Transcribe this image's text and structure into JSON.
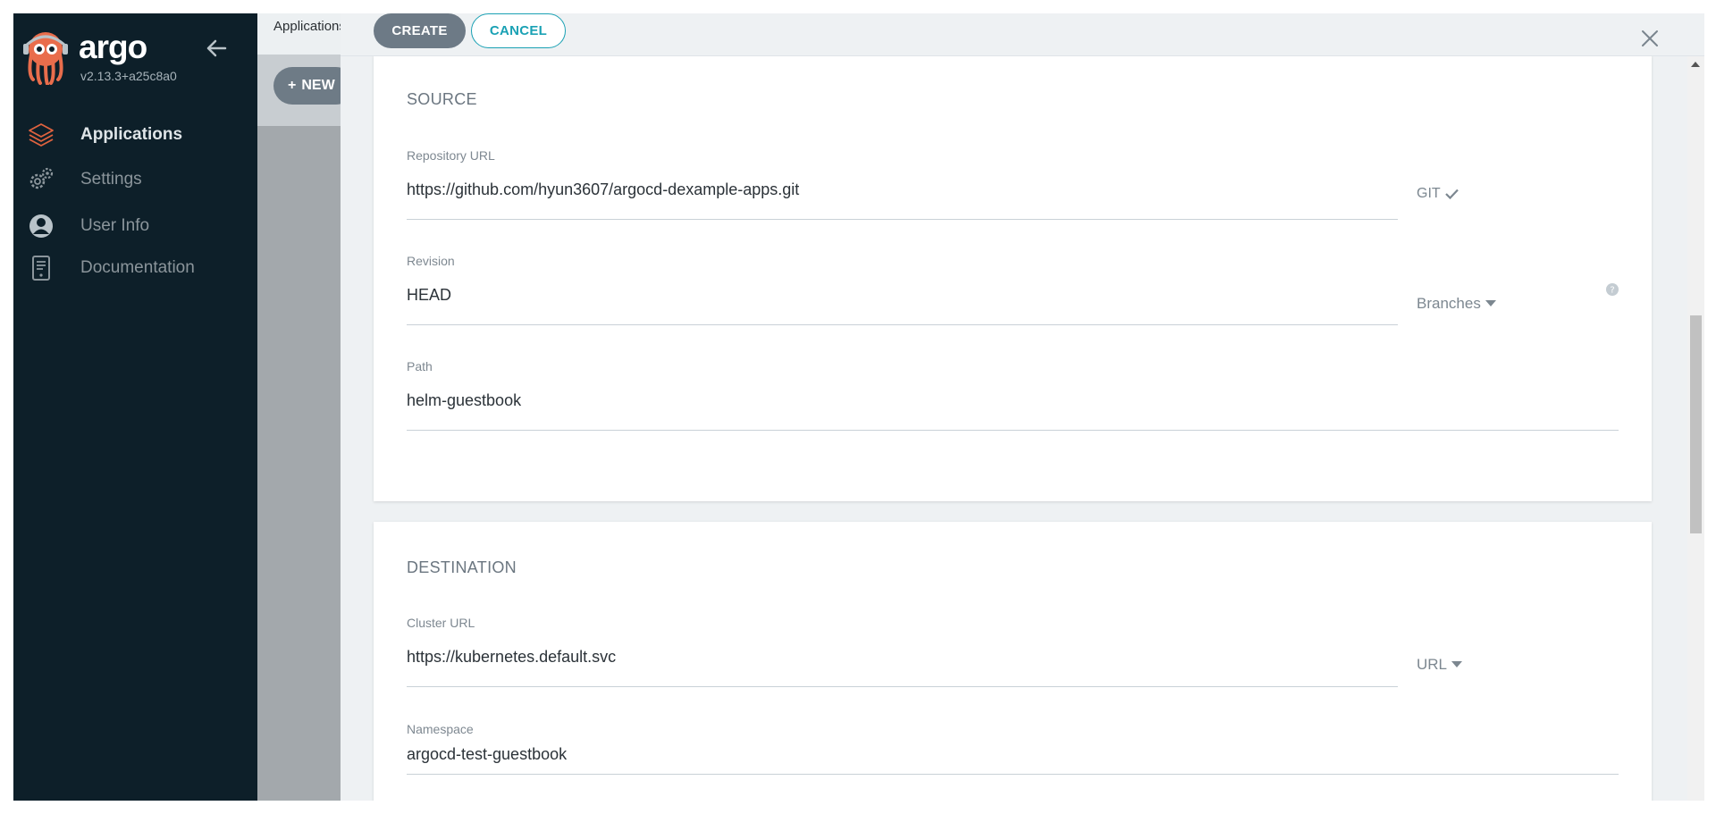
{
  "sidebar": {
    "brand": "argo",
    "version": "v2.13.3+a25c8a0",
    "items": [
      {
        "label": "Applications",
        "icon": "layers-icon",
        "active": true
      },
      {
        "label": "Settings",
        "icon": "gears-icon",
        "active": false
      },
      {
        "label": "User Info",
        "icon": "user-circle-icon",
        "active": false
      },
      {
        "label": "Documentation",
        "icon": "book-icon",
        "active": false
      }
    ]
  },
  "background": {
    "breadcrumb": "Applications",
    "new_button": "NEW"
  },
  "panel": {
    "create_label": "CREATE",
    "cancel_label": "CANCEL",
    "close_icon": "close-icon",
    "source": {
      "title": "SOURCE",
      "repo_label": "Repository URL",
      "repo_value": "https://github.com/hyun3607/argocd-dexample-apps.git",
      "repo_type": "GIT",
      "revision_label": "Revision",
      "revision_value": "HEAD",
      "revision_type": "Branches",
      "path_label": "Path",
      "path_value": "helm-guestbook"
    },
    "destination": {
      "title": "DESTINATION",
      "cluster_label": "Cluster URL",
      "cluster_value": "https://kubernetes.default.svc",
      "cluster_type": "URL",
      "namespace_label": "Namespace",
      "namespace_value": "argocd-test-guestbook"
    }
  },
  "colors": {
    "sidebar_bg": "#0d1f29",
    "accent": "#1aa1b4",
    "create_button": "#6d7a86",
    "active_icon": "#e0633f"
  }
}
